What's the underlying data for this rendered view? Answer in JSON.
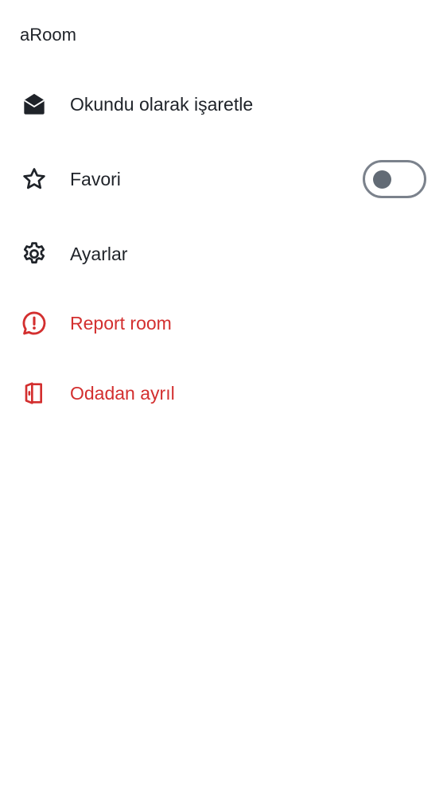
{
  "room": {
    "title": "aRoom"
  },
  "menu": {
    "items": [
      {
        "id": "mark-read",
        "label": "Okundu olarak işaretle",
        "icon": "envelope-open-icon"
      },
      {
        "id": "favorite",
        "label": "Favori",
        "icon": "star-outline-icon",
        "toggle": {
          "on": false
        }
      },
      {
        "id": "settings",
        "label": "Ayarlar",
        "icon": "gear-icon"
      },
      {
        "id": "report",
        "label": "Report room",
        "icon": "alert-bubble-icon",
        "danger": true
      },
      {
        "id": "leave",
        "label": "Odadan ayrıl",
        "icon": "door-exit-icon",
        "danger": true
      }
    ]
  },
  "colors": {
    "text": "#1f2329",
    "danger": "#d32f2f",
    "toggle_border": "#7b828c",
    "toggle_knob": "#626b75",
    "background": "#ffffff"
  }
}
